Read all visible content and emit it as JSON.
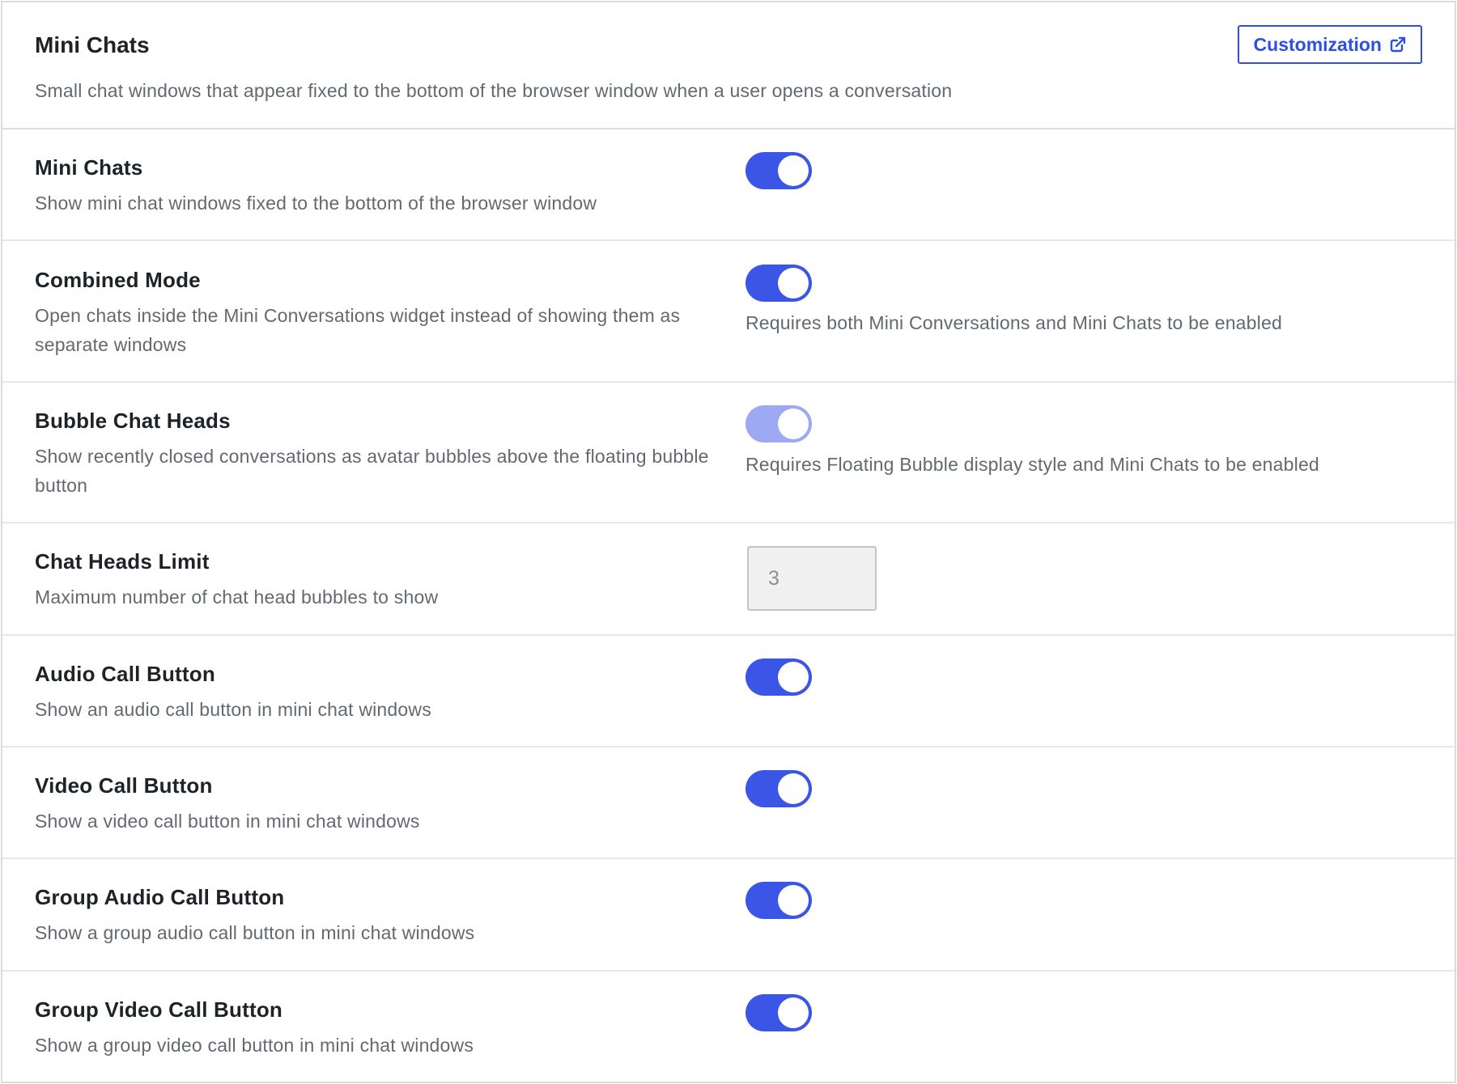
{
  "header": {
    "title": "Mini Chats",
    "description": "Small chat windows that appear fixed to the bottom of the browser window when a user opens a conversation",
    "customization_label": "Customization",
    "customization_icon": "external-link-icon"
  },
  "settings": [
    {
      "title": "Mini Chats",
      "description": "Show mini chat windows fixed to the bottom of the browser window",
      "control": "toggle",
      "enabled": true,
      "disabled": false
    },
    {
      "title": "Combined Mode",
      "description": "Open chats inside the Mini Conversations widget instead of showing them as separate windows",
      "control": "toggle",
      "enabled": true,
      "disabled": false,
      "note": "Requires both Mini Conversations and Mini Chats to be enabled"
    },
    {
      "title": "Bubble Chat Heads",
      "description": "Show recently closed conversations as avatar bubbles above the floating bubble button",
      "control": "toggle",
      "enabled": true,
      "disabled": true,
      "note": "Requires Floating Bubble display style and Mini Chats to be enabled"
    },
    {
      "title": "Chat Heads Limit",
      "description": "Maximum number of chat head bubbles to show",
      "control": "number",
      "value": "3",
      "disabled": true
    },
    {
      "title": "Audio Call Button",
      "description": "Show an audio call button in mini chat windows",
      "control": "toggle",
      "enabled": true,
      "disabled": false
    },
    {
      "title": "Video Call Button",
      "description": "Show a video call button in mini chat windows",
      "control": "toggle",
      "enabled": true,
      "disabled": false
    },
    {
      "title": "Group Audio Call Button",
      "description": "Show a group audio call button in mini chat windows",
      "control": "toggle",
      "enabled": true,
      "disabled": false
    },
    {
      "title": "Group Video Call Button",
      "description": "Show a group video call button in mini chat windows",
      "control": "toggle",
      "enabled": true,
      "disabled": false
    }
  ],
  "colors": {
    "accent": "#3b56e6",
    "accent_disabled": "#9ea9f3",
    "border": "#dcdcde",
    "muted_text": "#646970"
  }
}
